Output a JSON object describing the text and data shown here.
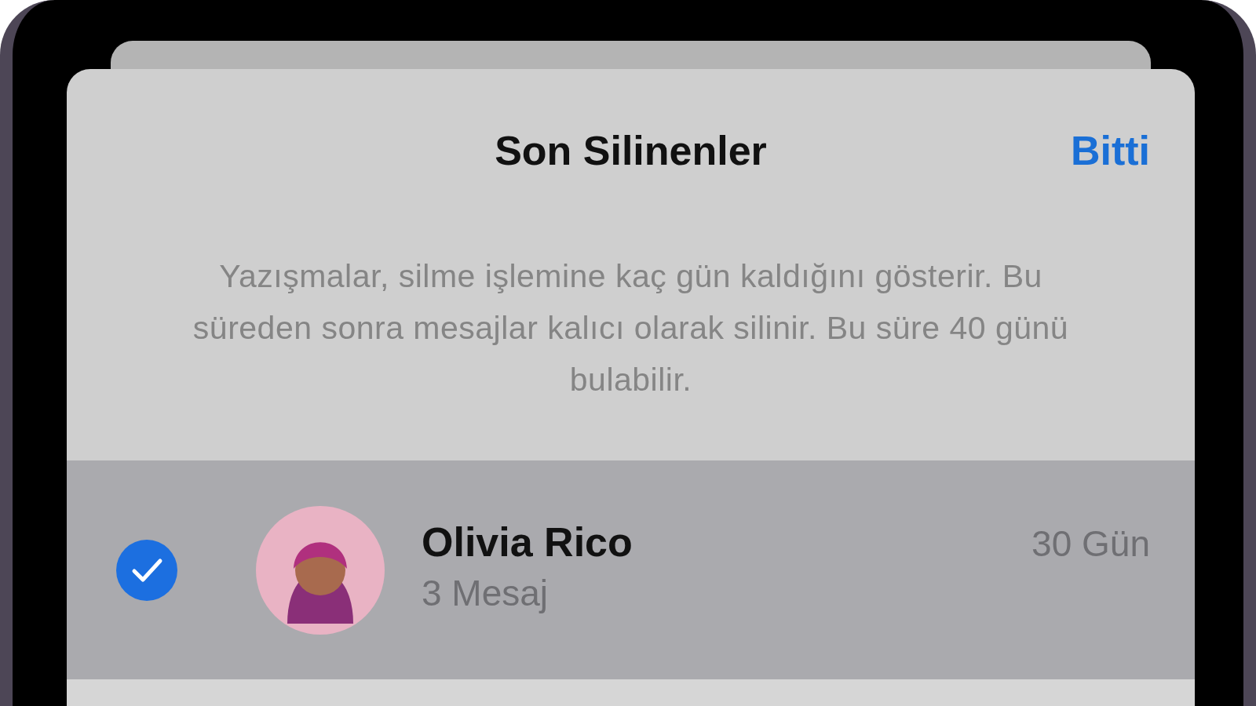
{
  "sheet": {
    "title": "Son Silinenler",
    "done_button": "Bitti"
  },
  "description": "Yazışmalar, silme işlemine kaç gün kaldığını gösterir. Bu süreden sonra mesajlar kalıcı olarak silinir. Bu süre 40 günü bulabilir.",
  "conversations": [
    {
      "name": "Olivia Rico",
      "count": "3 Mesaj",
      "days": "30 Gün",
      "selected": true
    }
  ]
}
